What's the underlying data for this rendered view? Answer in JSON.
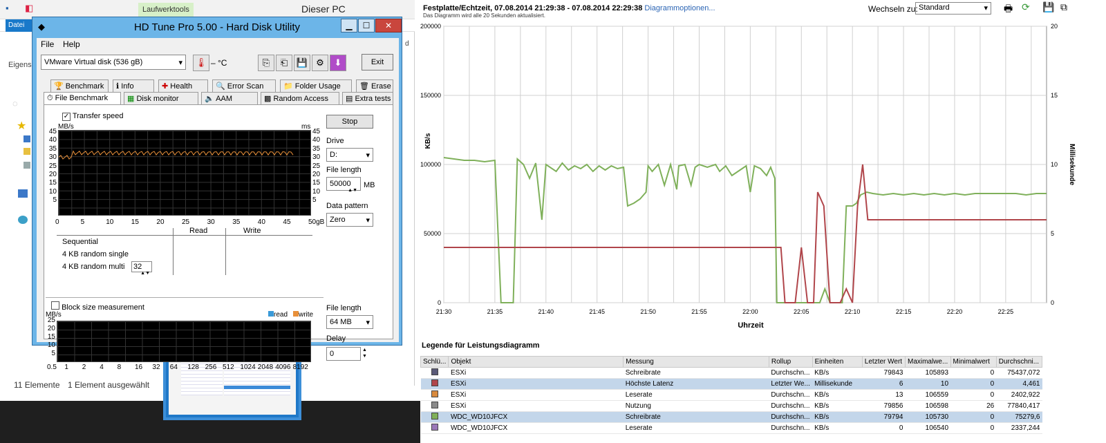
{
  "explorer": {
    "title": "Dieser PC",
    "tools_tab": "Laufwerktools",
    "file_tab": "Datei",
    "partial_label": "Eigens",
    "status_count": "11 Elemente",
    "status_selected": "1 Element ausgewählt"
  },
  "hdtune": {
    "title": "HD Tune Pro 5.00 - Hard Disk Utility",
    "menu": [
      "File",
      "Help"
    ],
    "drive": "VMware  Virtual disk     (536 gB)",
    "temperature": "– °C",
    "exit_label": "Exit",
    "tabs_row1": [
      "Benchmark",
      "Info",
      "Health",
      "Error Scan",
      "Folder Usage",
      "Erase"
    ],
    "tabs_row2": [
      "File Benchmark",
      "Disk monitor",
      "AAM",
      "Random Access",
      "Extra tests"
    ],
    "transfer_speed_label": "Transfer speed",
    "transfer_speed_checked": true,
    "unit_left": "MB/s",
    "unit_right": "ms",
    "y_ticks": [
      "45",
      "40",
      "35",
      "30",
      "25",
      "20",
      "15",
      "10",
      "5"
    ],
    "x_ticks": [
      "0",
      "5",
      "10",
      "15",
      "20",
      "25",
      "30",
      "35",
      "40",
      "45",
      "50gB"
    ],
    "col_read": "Read",
    "col_write": "Write",
    "row_sequential": "Sequential",
    "row_4k_single": "4 KB random single",
    "row_4k_multi": "4 KB random multi",
    "queue_depth": "32",
    "stop_label": "Stop",
    "drive_label": "Drive",
    "drive_value": "D:",
    "file_length_label": "File length",
    "file_length_value": "50000",
    "file_length_unit": "MB",
    "data_pattern_label": "Data pattern",
    "data_pattern_value": "Zero",
    "block_size_label": "Block size measurement",
    "block_size_checked": false,
    "block_unit": "MB/s",
    "legend_read": "read",
    "legend_write": "write",
    "block_y_ticks": [
      "25",
      "20",
      "15",
      "10",
      "5"
    ],
    "block_x_ticks": [
      "0.5",
      "1",
      "2",
      "4",
      "8",
      "16",
      "32",
      "64",
      "128",
      "256",
      "512",
      "1024",
      "2048",
      "4096",
      "8192"
    ],
    "block_file_length_label": "File length",
    "block_file_length_value": "64 MB",
    "delay_label": "Delay",
    "delay_value": "0"
  },
  "perf": {
    "title": "Festplatte/Echtzeit, 07.08.2014 21:29:38 - 07.08.2014 22:29:38",
    "options_link": "Diagrammoptionen...",
    "subtitle": "Das Diagramm wird alle 20 Sekunden aktualisiert.",
    "switch_label": "Wechseln zu:",
    "switch_value": "Standard",
    "legend_title": "Legende für Leistungsdiagramm",
    "legend_headers": [
      "Schlü...",
      "Objekt",
      "Messung",
      "Rollup",
      "Einheiten",
      "Letzter Wert",
      "Maximalwe...",
      "Minimalwert",
      "Durchschni..."
    ],
    "legend_rows": [
      {
        "color": "#5a5a78",
        "object": "ESXi",
        "measure": "Schreibrate",
        "rollup": "Durchschn...",
        "unit": "KB/s",
        "last": "79843",
        "max": "105893",
        "min": "0",
        "avg": "75437,072",
        "selected": false
      },
      {
        "color": "#b0454a",
        "object": "ESXi",
        "measure": "Höchste Latenz",
        "rollup": "Letzter We...",
        "unit": "Millisekunde",
        "last": "6",
        "max": "10",
        "min": "0",
        "avg": "4,461",
        "selected": true
      },
      {
        "color": "#d88a3e",
        "object": "ESXi",
        "measure": "Leserate",
        "rollup": "Durchschn...",
        "unit": "KB/s",
        "last": "13",
        "max": "106559",
        "min": "0",
        "avg": "2402,922",
        "selected": false
      },
      {
        "color": "#8a8a8a",
        "object": "ESXi",
        "measure": "Nutzung",
        "rollup": "Durchschn...",
        "unit": "KB/s",
        "last": "79856",
        "max": "106598",
        "min": "26",
        "avg": "77840,417",
        "selected": false
      },
      {
        "color": "#7fb05a",
        "object": "WDC_WD10JFCX",
        "measure": "Schreibrate",
        "rollup": "Durchschn...",
        "unit": "KB/s",
        "last": "79794",
        "max": "105730",
        "min": "0",
        "avg": "75279,6",
        "selected": true
      },
      {
        "color": "#9a78b8",
        "object": "WDC_WD10JFCX",
        "measure": "Leserate",
        "rollup": "Durchschn...",
        "unit": "KB/s",
        "last": "0",
        "max": "106540",
        "min": "0",
        "avg": "2337,244",
        "selected": false
      }
    ]
  },
  "chart_data": {
    "type": "line",
    "xlabel": "Uhrzeit",
    "ylabel": "KB/s",
    "ylabel_right": "Millisekunde",
    "x_ticks": [
      "21:30",
      "21:35",
      "21:40",
      "21:45",
      "21:50",
      "21:55",
      "22:00",
      "22:05",
      "22:10",
      "22:15",
      "22:20",
      "22:25"
    ],
    "y_ticks": [
      "0",
      "50000",
      "100000",
      "150000",
      "200000"
    ],
    "y2_ticks": [
      "0",
      "5",
      "10",
      "15",
      "20"
    ],
    "ylim": [
      0,
      200000
    ],
    "y2lim": [
      0,
      20
    ],
    "xlim": [
      0,
      59
    ],
    "grid": true,
    "series": [
      {
        "name": "Schreibrate",
        "color": "#7fb05a",
        "axis": "left",
        "x": [
          0,
          1,
          2,
          3,
          4,
          5,
          5.6,
          6,
          6.4,
          6.8,
          7.2,
          7.8,
          8.4,
          9,
          9.6,
          10,
          11,
          11.6,
          12.2,
          12.8,
          13.4,
          14,
          14.6,
          15.2,
          15.8,
          16.4,
          17,
          17.6,
          18,
          18.6,
          19.2,
          19.8,
          20,
          20.4,
          21,
          21.6,
          22.2,
          22.8,
          23,
          23.6,
          24.2,
          24.6,
          25,
          25.8,
          26.6,
          27,
          27.6,
          28.2,
          29,
          29.6,
          30,
          30.4,
          31,
          31.6,
          32,
          32.4,
          32.6,
          33,
          35,
          35.6,
          36.2,
          36.8,
          37.3,
          37.8,
          38.4,
          39,
          39.4,
          40,
          40.4,
          40.8,
          41.4,
          42,
          43,
          44,
          45,
          46,
          47,
          48,
          49,
          50,
          51,
          52,
          53,
          54,
          55,
          56,
          57,
          58,
          59
        ],
        "y": [
          105000,
          104000,
          103000,
          103000,
          102000,
          103000,
          0,
          0,
          0,
          0,
          104000,
          100000,
          90000,
          101000,
          60000,
          100000,
          95000,
          101000,
          96000,
          99000,
          97000,
          100000,
          95000,
          99000,
          96000,
          99000,
          97000,
          98000,
          70000,
          72000,
          75000,
          80000,
          99000,
          95000,
          100000,
          85000,
          100000,
          82000,
          99000,
          100000,
          85000,
          98000,
          100000,
          98000,
          100000,
          95000,
          99000,
          92000,
          96000,
          99000,
          80000,
          99000,
          97000,
          92000,
          98000,
          90000,
          0,
          0,
          0,
          0,
          0,
          0,
          10000,
          0,
          0,
          0,
          70000,
          70000,
          72000,
          78000,
          80000,
          79000,
          78000,
          79000,
          78000,
          79000,
          78000,
          79000,
          78000,
          79000,
          78000,
          79000,
          79000,
          79000,
          79000,
          79000,
          78000,
          79000,
          79000
        ]
      },
      {
        "name": "Höchste Latenz",
        "color": "#b0454a",
        "axis": "right",
        "x": [
          0,
          33,
          33.4,
          34.4,
          35,
          35.6,
          36.2,
          36.6,
          37.2,
          37.8,
          38.3,
          38.8,
          39.4,
          40,
          40.5,
          41,
          41.5,
          42,
          59
        ],
        "y": [
          4,
          4,
          0,
          0,
          4,
          0,
          0,
          8,
          7,
          0,
          0,
          0,
          1,
          0,
          7,
          10,
          6,
          6,
          6
        ]
      }
    ]
  }
}
